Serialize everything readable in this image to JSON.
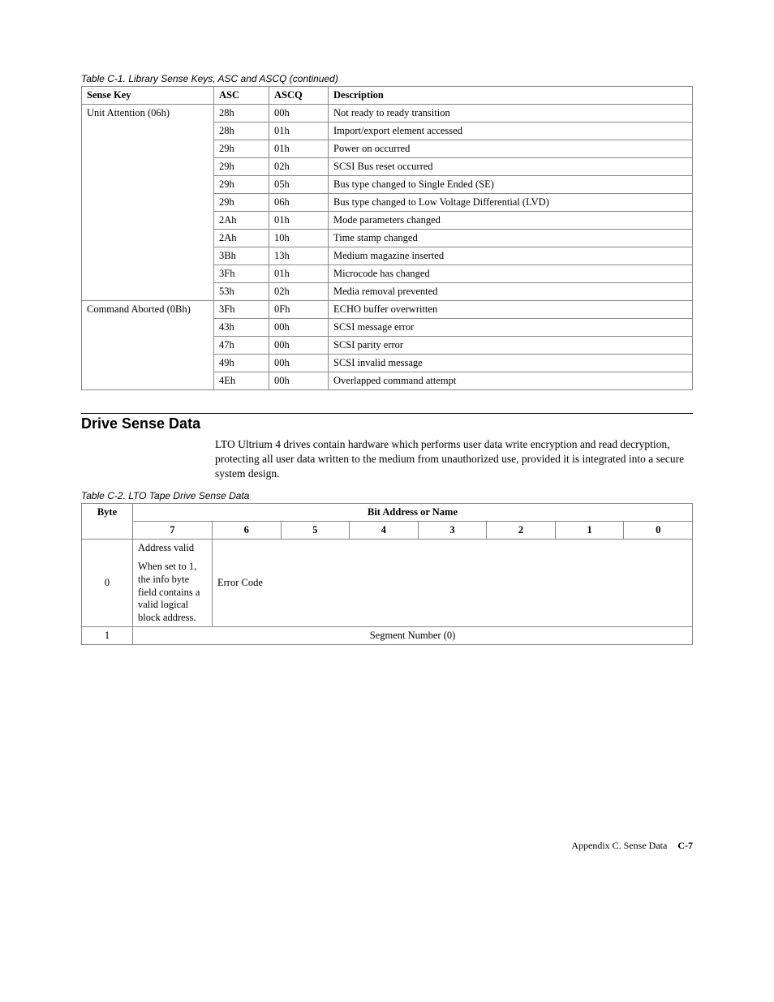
{
  "table1": {
    "caption": "Table C-1. Library Sense Keys, ASC and ASCQ  (continued)",
    "headers": {
      "sense_key": "Sense Key",
      "asc": "ASC",
      "ascq": "ASCQ",
      "desc": "Description"
    },
    "group1": {
      "sense_key": "Unit Attention (06h)",
      "rows": [
        {
          "asc": "28h",
          "ascq": "00h",
          "desc": "Not ready to ready transition"
        },
        {
          "asc": "28h",
          "ascq": "01h",
          "desc": "Import/export element accessed"
        },
        {
          "asc": "29h",
          "ascq": "01h",
          "desc": "Power on occurred"
        },
        {
          "asc": "29h",
          "ascq": "02h",
          "desc": "SCSI Bus reset occurred"
        },
        {
          "asc": "29h",
          "ascq": "05h",
          "desc": "Bus type changed to Single Ended (SE)"
        },
        {
          "asc": "29h",
          "ascq": "06h",
          "desc": "Bus type changed to Low Voltage Differential (LVD)"
        },
        {
          "asc": "2Ah",
          "ascq": "01h",
          "desc": "Mode parameters changed"
        },
        {
          "asc": "2Ah",
          "ascq": "10h",
          "desc": "Time stamp changed"
        },
        {
          "asc": "3Bh",
          "ascq": "13h",
          "desc": "Medium magazine inserted"
        },
        {
          "asc": "3Fh",
          "ascq": "01h",
          "desc": "Microcode has changed"
        },
        {
          "asc": "53h",
          "ascq": "02h",
          "desc": "Media removal prevented"
        }
      ]
    },
    "group2": {
      "sense_key": "Command Aborted (0Bh)",
      "rows": [
        {
          "asc": "3Fh",
          "ascq": "0Fh",
          "desc": "ECHO buffer overwritten"
        },
        {
          "asc": "43h",
          "ascq": "00h",
          "desc": "SCSI message error"
        },
        {
          "asc": "47h",
          "ascq": "00h",
          "desc": "SCSI parity error"
        },
        {
          "asc": "49h",
          "ascq": "00h",
          "desc": "SCSI invalid message"
        },
        {
          "asc": "4Eh",
          "ascq": "00h",
          "desc": "Overlapped command attempt"
        }
      ]
    }
  },
  "section": {
    "heading": "Drive Sense Data",
    "body": "LTO Ultrium 4 drives contain hardware which performs user data write encryption and read decryption, protecting all user data written to the medium from unauthorized use, provided it is integrated into a secure system design."
  },
  "table2": {
    "caption": "Table C-2. LTO Tape Drive Sense Data",
    "h_group": "Bit Address or Name",
    "h_byte": "Byte",
    "bits": {
      "b7": "7",
      "b6": "6",
      "b5": "5",
      "b4": "4",
      "b3": "3",
      "b2": "2",
      "b1": "1",
      "b0": "0"
    },
    "r0": {
      "byte": "0",
      "bit7_line1": "Address valid",
      "bit7_line2": "When set to 1, the info byte field contains a valid logical block address.",
      "rest": "Error Code"
    },
    "r1": {
      "byte": "1",
      "val": "Segment Number (0)"
    }
  },
  "footer": {
    "text": "Appendix C. Sense Data",
    "page": "C-7"
  }
}
